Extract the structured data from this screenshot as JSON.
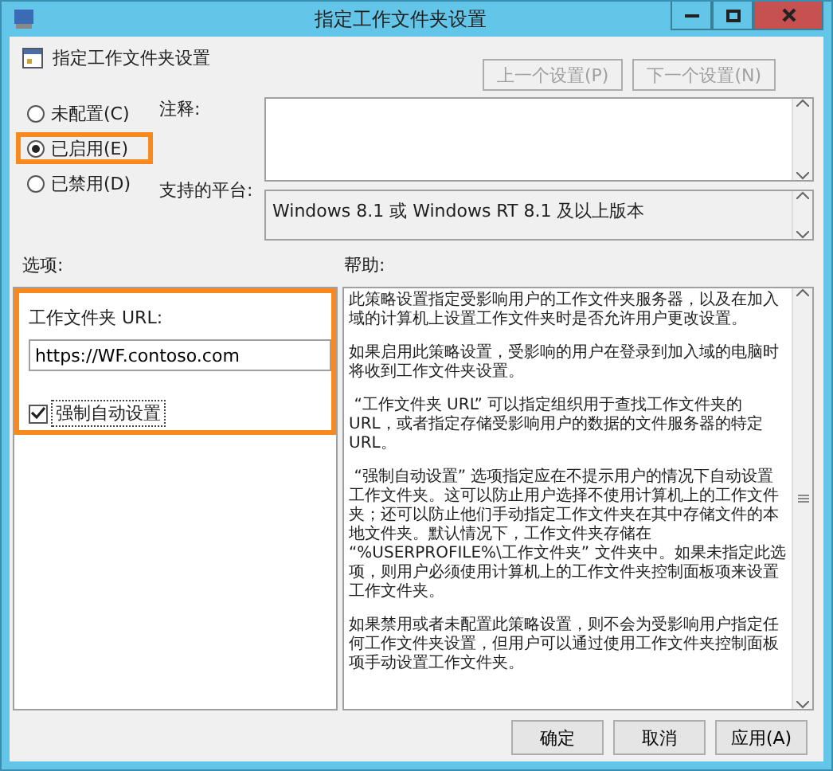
{
  "window": {
    "title": "指定工作文件夹设置"
  },
  "header": {
    "title": "指定工作文件夹设置"
  },
  "nav_buttons": [
    {
      "label": "上一个设置(P)",
      "disabled": true
    },
    {
      "label": "下一个设置(N)",
      "disabled": true
    }
  ],
  "radios": [
    {
      "label": "未配置(C)",
      "selected": false,
      "highlighted": false
    },
    {
      "label": "已启用(E)",
      "selected": true,
      "highlighted": true
    },
    {
      "label": "已禁用(D)",
      "selected": false,
      "highlighted": false
    }
  ],
  "comment": {
    "label": "注释:"
  },
  "platform": {
    "label": "支持的平台:",
    "value": "Windows 8.1 或 Windows RT 8.1 及以上版本"
  },
  "options": {
    "label": "选项:",
    "highlighted": true,
    "url_label": "工作文件夹 URL:",
    "url_value": "https://WF.contoso.com",
    "force": {
      "label": "强制自动设置",
      "checked": true
    }
  },
  "help": {
    "label": "帮助:",
    "paragraphs": [
      "此策略设置指定受影响用户的工作文件夹服务器，以及在加入域的计算机上设置工作文件夹时是否允许用户更改设置。",
      "如果启用此策略设置，受影响的用户在登录到加入域的电脑时将收到工作文件夹设置。",
      " “工作文件夹 URL” 可以指定组织用于查找工作文件夹的 URL，或者指定存储受影响用户的数据的文件服务器的特定 URL。",
      " “强制自动设置” 选项指定应在不提示用户的情况下自动设置工作文件夹。这可以防止用户选择不使用计算机上的工作文件夹；还可以防止他们手动指定工作文件夹在其中存储文件的本地文件夹。默认情况下，工作文件夹存储在 “%USERPROFILE%\\工作文件夹” 文件夹中。如果未指定此选项，则用户必须使用计算机上的工作文件夹控制面板项来设置工作文件夹。",
      "如果禁用或者未配置此策略设置，则不会为受影响用户指定任何工作文件夹设置，但用户可以通过使用工作文件夹控制面板项手动设置工作文件夹。"
    ]
  },
  "buttons": [
    "确定",
    "取消",
    "应用(A)"
  ]
}
